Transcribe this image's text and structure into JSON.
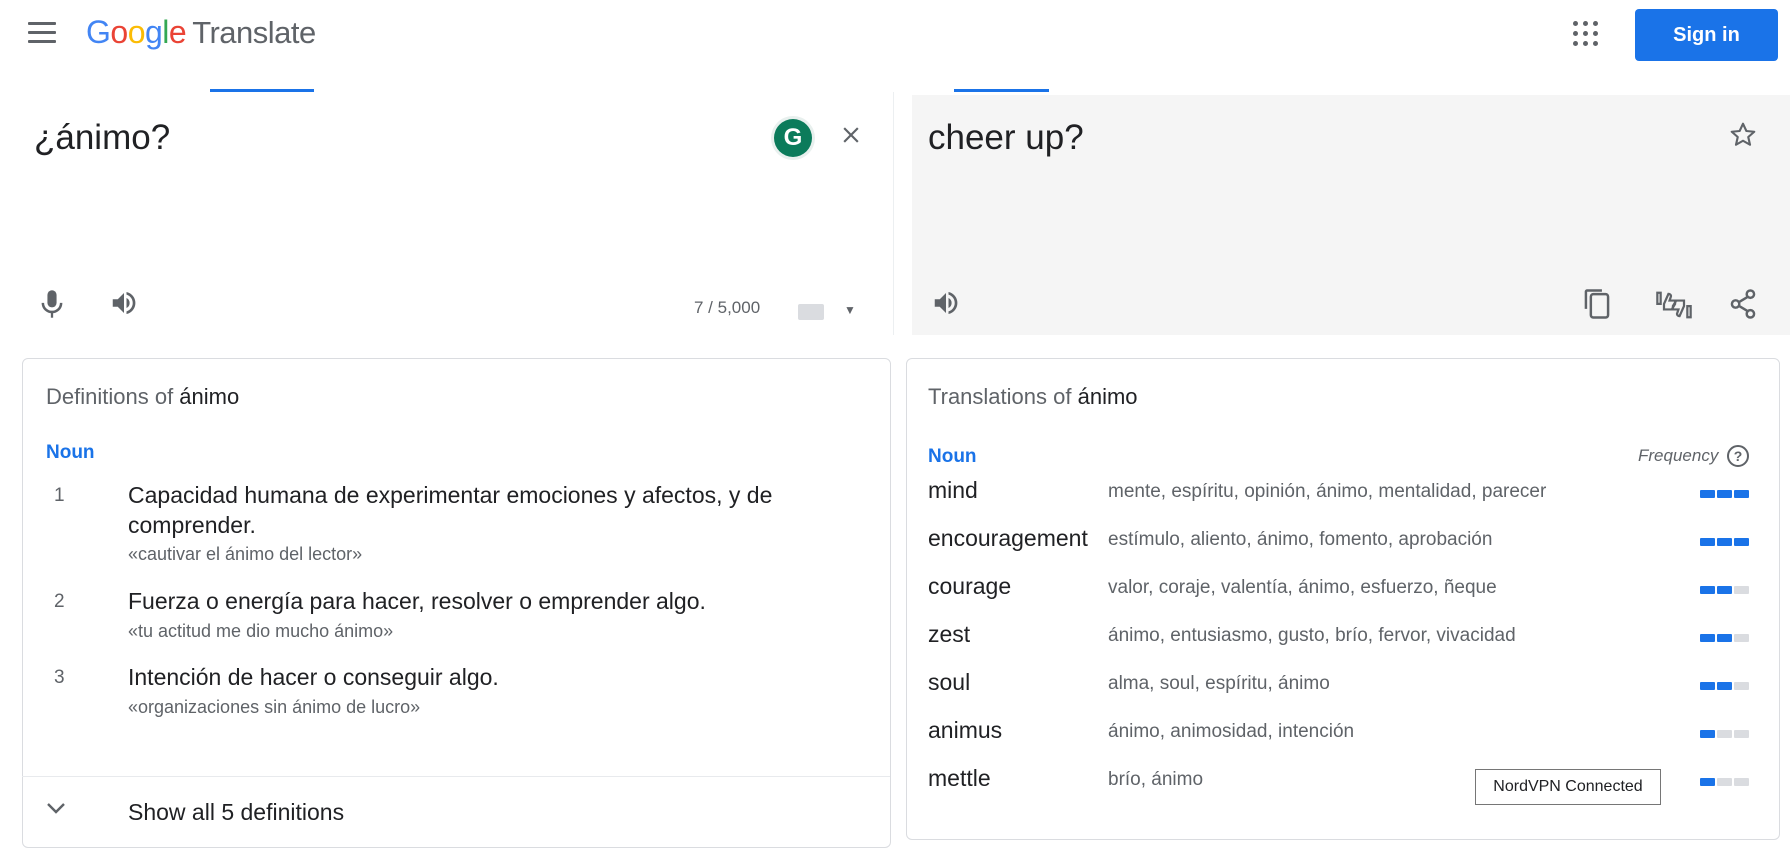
{
  "header": {
    "logo_letters": [
      {
        "ch": "G",
        "color": "#4285F4"
      },
      {
        "ch": "o",
        "color": "#EA4335"
      },
      {
        "ch": "o",
        "color": "#FBBC05"
      },
      {
        "ch": "g",
        "color": "#4285F4"
      },
      {
        "ch": "l",
        "color": "#34A853"
      },
      {
        "ch": "e",
        "color": "#EA4335"
      }
    ],
    "product": "Translate",
    "signin_label": "Sign in",
    "accent_color": "#1a73e8"
  },
  "source": {
    "text": "¿ánimo?",
    "char_count": "7 / 5,000",
    "grammarly_letter": "G"
  },
  "target": {
    "text": "cheer up?"
  },
  "definitions": {
    "title_prefix": "Definitions of ",
    "word": "ánimo",
    "pos": "Noun",
    "items": [
      {
        "num": "1",
        "text": "Capacidad humana de experimentar emociones y afectos, y de comprender.",
        "example": "«cautivar el ánimo del lector»"
      },
      {
        "num": "2",
        "text": "Fuerza o energía para hacer, resolver o emprender algo.",
        "example": "«tu actitud me dio mucho ánimo»"
      },
      {
        "num": "3",
        "text": "Intención de hacer o conseguir algo.",
        "example": "«organizaciones sin ánimo de lucro»"
      }
    ],
    "show_all": "Show all 5 definitions"
  },
  "translations": {
    "title_prefix": "Translations of ",
    "word": "ánimo",
    "pos": "Noun",
    "frequency_label": "Frequency",
    "rows": [
      {
        "word": "mind",
        "synonyms": "mente, espíritu, opinión, ánimo, mentalidad, parecer",
        "frequency": 3
      },
      {
        "word": "encouragement",
        "synonyms": "estímulo, aliento, ánimo, fomento, aprobación",
        "frequency": 3
      },
      {
        "word": "courage",
        "synonyms": "valor, coraje, valentía, ánimo, esfuerzo, ñeque",
        "frequency": 2
      },
      {
        "word": "zest",
        "synonyms": "ánimo, entusiasmo, gusto, brío, fervor, vivacidad",
        "frequency": 2
      },
      {
        "word": "soul",
        "synonyms": "alma, soul, espíritu, ánimo",
        "frequency": 2
      },
      {
        "word": "animus",
        "synonyms": "ánimo, animosidad, intención",
        "frequency": 1
      },
      {
        "word": "mettle",
        "synonyms": "brío, ánimo",
        "frequency": 1
      }
    ]
  },
  "tooltip": "NordVPN Connected"
}
